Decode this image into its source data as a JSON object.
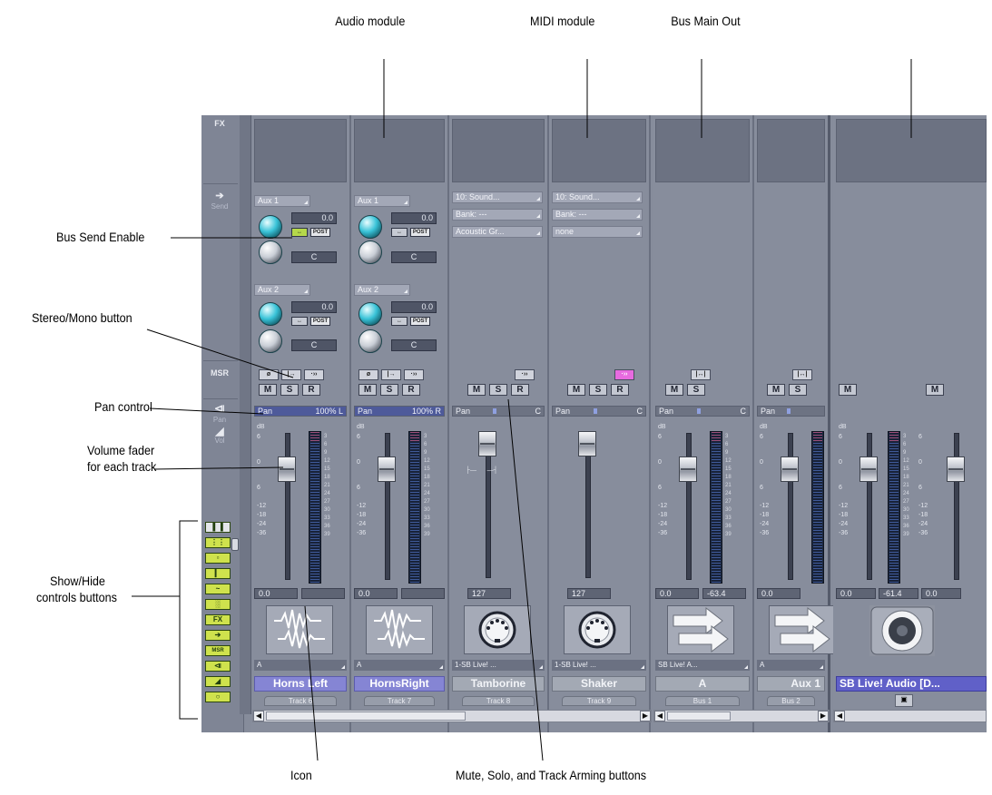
{
  "annotations": {
    "audio_module": "Audio module",
    "midi_module": "MIDI module",
    "bus_main_out": "Bus Main Out",
    "bus_send_enable": "Bus Send Enable",
    "stereo_mono": "Stereo/Mono button",
    "pan_control": "Pan control",
    "volume_fader_1": "Volume fader",
    "volume_fader_2": "for each track",
    "showhide_1": "Show/Hide",
    "showhide_2": "controls buttons",
    "icon": "Icon",
    "msr_buttons": "Mute, Solo, and Track Arming buttons"
  },
  "left_panel": {
    "fx": "FX",
    "send": "Send",
    "msr": "MSR",
    "pan": "Pan",
    "vol": "Vol",
    "showhide_buttons": [
      "FX",
      "MSR"
    ]
  },
  "db_scale": {
    "label": "dB",
    "fader_marks": [
      "6",
      "0",
      "6",
      "-12",
      "-18",
      "-24",
      "-36"
    ],
    "meter_ticks": "3\n6\n9\n12\n15\n18\n21\n24\n27\n30\n33\n36\n39"
  },
  "buttons": {
    "mute": "M",
    "solo": "S",
    "arm": "R",
    "post": "POST",
    "pan_label": "Pan",
    "center": "C"
  },
  "tracks": [
    {
      "aux1_label": "Aux 1",
      "aux1_value": "0.0",
      "aux1_pan": "C",
      "aux2_label": "Aux 2",
      "aux2_value": "0.0",
      "aux2_pan": "C",
      "pan_value": "100% L",
      "volume": "0.0",
      "io": "A",
      "name": "Horns Left",
      "number": "Track 6"
    },
    {
      "aux1_label": "Aux 1",
      "aux1_value": "0.0",
      "aux1_pan": "C",
      "aux2_label": "Aux 2",
      "aux2_value": "0.0",
      "aux2_pan": "C",
      "pan_value": "100% R",
      "volume": "0.0",
      "io": "A",
      "name": "HornsRight",
      "number": "Track 7"
    },
    {
      "port": "10: Sound...",
      "bank": "Bank: ---",
      "patch": "Acoustic Gr...",
      "pan_value": "C",
      "volume": "127",
      "io": "1-SB Live! ...",
      "name": "Tamborine",
      "number": "Track 8"
    },
    {
      "port": "10: Sound...",
      "bank": "Bank: ---",
      "patch": "none",
      "pan_value": "C",
      "volume": "127",
      "io": "1-SB Live! ...",
      "name": "Shaker",
      "number": "Track 9"
    },
    {
      "pan_value": "C",
      "volume": "0.0",
      "peak": "-63.4",
      "io": "SB Live! A...",
      "name": "A",
      "number": "Bus 1"
    },
    {
      "pan_value": "C",
      "volume": "0.0",
      "io": "A",
      "name": "Aux 1",
      "number": "Bus 2"
    },
    {
      "volume": "0.0",
      "peak": "-61.4",
      "volume2": "0.0",
      "name": "SB Live! Audio [D..."
    }
  ]
}
